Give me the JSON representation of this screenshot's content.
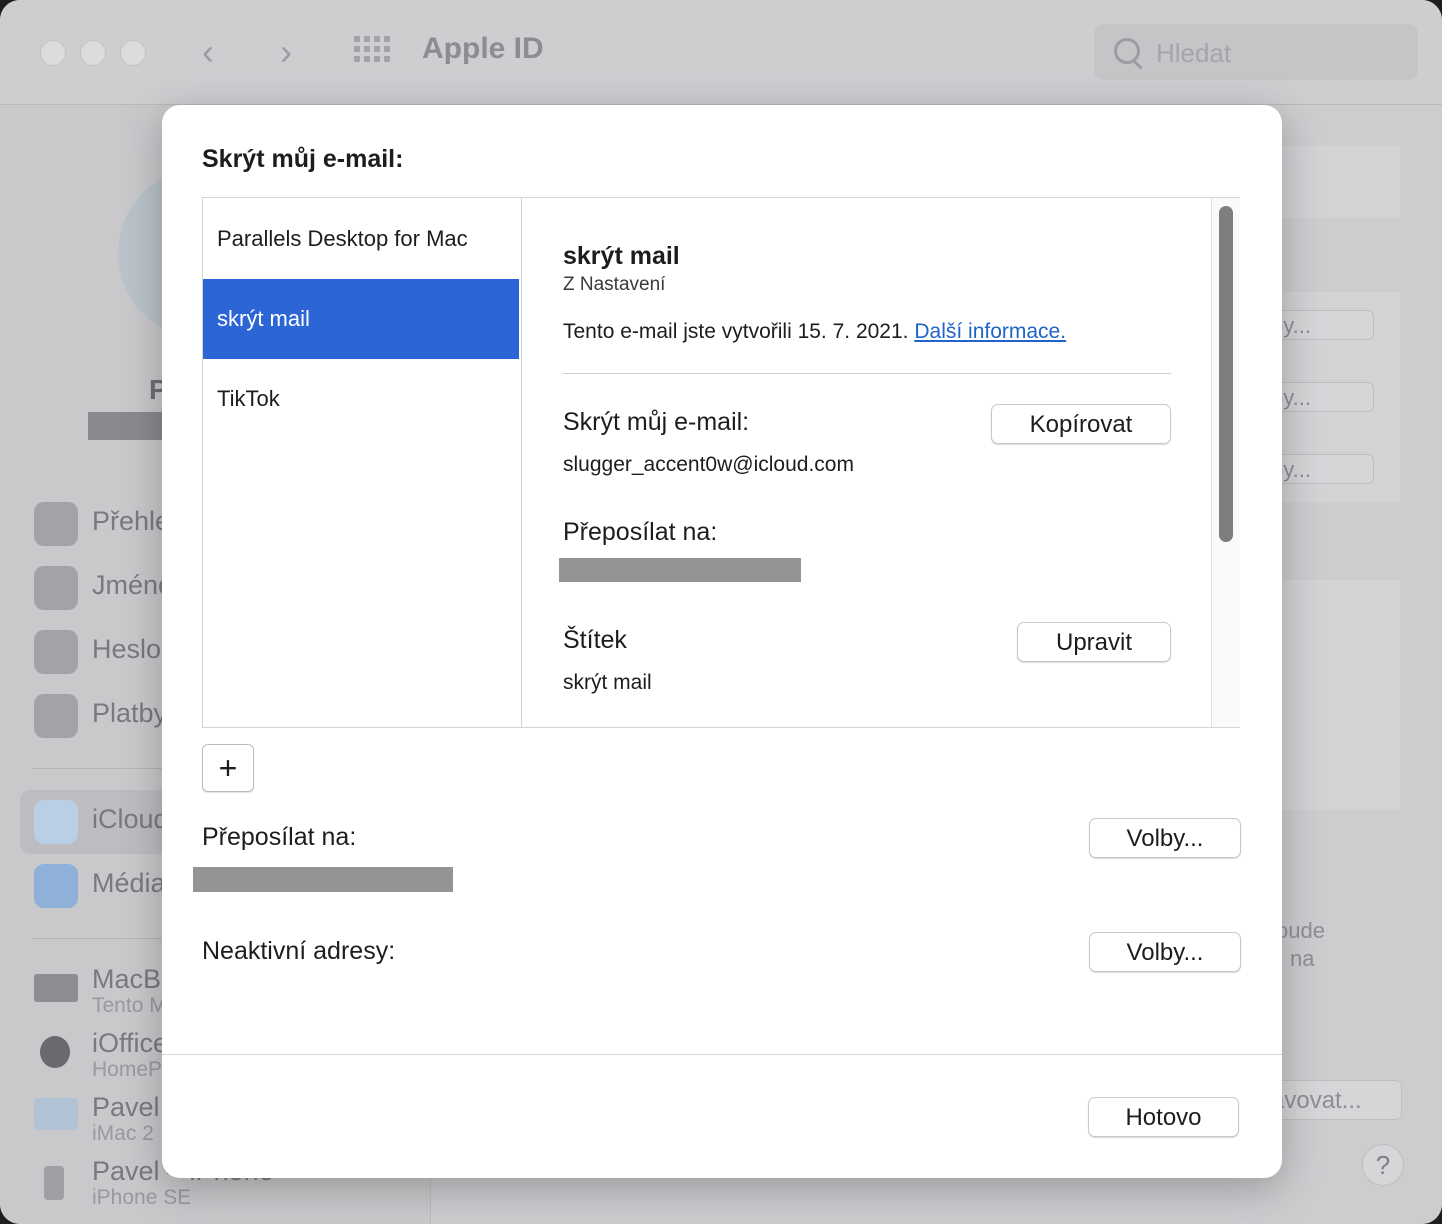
{
  "window": {
    "title": "Apple ID",
    "search_placeholder": "Hledat"
  },
  "sidebar": {
    "user_initial": "P",
    "items": [
      {
        "label": "Přehle",
        "icon": "apple-icon"
      },
      {
        "label": "Jméno",
        "icon": "person-icon"
      },
      {
        "label": "Heslo",
        "icon": "lock-icon"
      },
      {
        "label": "Platby",
        "icon": "card-icon"
      },
      {
        "label": "iCloud",
        "icon": "cloud-icon"
      },
      {
        "label": "Média",
        "icon": "appstore-icon"
      }
    ],
    "devices": [
      {
        "name": "MacBo",
        "sub": "Tento M"
      },
      {
        "name": "iOffice",
        "sub": "HomeP"
      },
      {
        "name": "Pavel",
        "sub": "iMac 2"
      },
      {
        "name": "Pavel – iPhone",
        "sub": "iPhone SE"
      }
    ]
  },
  "background": {
    "buttons": [
      "by...",
      "by...",
      "by...",
      "avovat..."
    ],
    "text_lines": [
      "oude",
      "na"
    ],
    "help": "?"
  },
  "sheet": {
    "title": "Skrýt můj e-mail:",
    "list": [
      {
        "label": "Parallels Desktop for Mac",
        "selected": false
      },
      {
        "label": "skrýt mail",
        "selected": true
      },
      {
        "label": "TikTok",
        "selected": false
      }
    ],
    "detail": {
      "title": "skrýt mail",
      "subtitle": "Z Nastavení",
      "created_text": "Tento e-mail jste vytvořili 15. 7. 2021.",
      "more_info_link": "Další informace.",
      "hide_label": "Skrýt můj e-mail:",
      "copy_button": "Kopírovat",
      "hidden_email": "slugger_accent0w@icloud.com",
      "forward_label": "Přeposílat na:",
      "tag_label": "Štítek",
      "edit_button": "Upravit",
      "tag_value": "skrýt mail"
    },
    "add_button": "+",
    "forward_label": "Přeposílat na:",
    "forward_options_button": "Volby...",
    "inactive_label": "Neaktivní adresy:",
    "inactive_options_button": "Volby...",
    "done_button": "Hotovo"
  }
}
